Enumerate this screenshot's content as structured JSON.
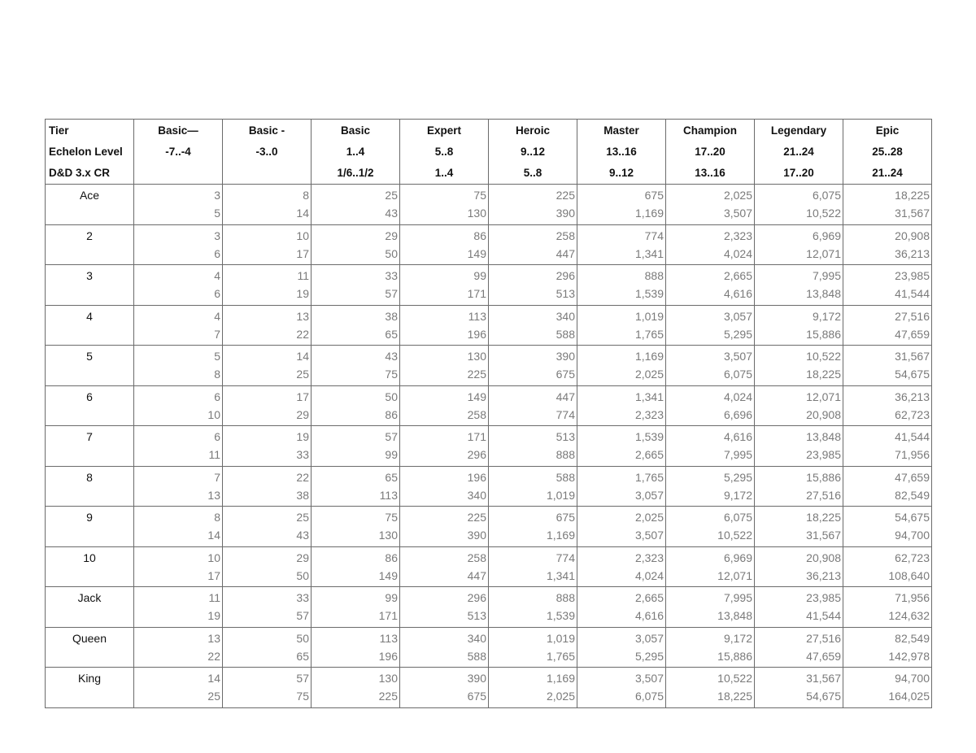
{
  "table": {
    "header_rows": [
      {
        "label": "Tier",
        "values": [
          "Basic—",
          "Basic -",
          "Basic",
          "Expert",
          "Heroic",
          "Master",
          "Champion",
          "Legendary",
          "Epic"
        ]
      },
      {
        "label": "Echelon Level",
        "values": [
          "-7..-4",
          "-3..0",
          "1..4",
          "5..8",
          "9..12",
          "13..16",
          "17..20",
          "21..24",
          "25..28"
        ]
      },
      {
        "label": "D&D 3.x CR",
        "values": [
          "",
          "",
          "1/6..1/2",
          "1..4",
          "5..8",
          "9..12",
          "13..16",
          "17..20",
          "21..24"
        ]
      }
    ],
    "rows": [
      {
        "label": "Ace",
        "top": [
          "3",
          "8",
          "25",
          "75",
          "225",
          "675",
          "2,025",
          "6,075",
          "18,225"
        ],
        "bottom": [
          "5",
          "14",
          "43",
          "130",
          "390",
          "1,169",
          "3,507",
          "10,522",
          "31,567"
        ]
      },
      {
        "label": "2",
        "top": [
          "3",
          "10",
          "29",
          "86",
          "258",
          "774",
          "2,323",
          "6,969",
          "20,908"
        ],
        "bottom": [
          "6",
          "17",
          "50",
          "149",
          "447",
          "1,341",
          "4,024",
          "12,071",
          "36,213"
        ]
      },
      {
        "label": "3",
        "top": [
          "4",
          "11",
          "33",
          "99",
          "296",
          "888",
          "2,665",
          "7,995",
          "23,985"
        ],
        "bottom": [
          "6",
          "19",
          "57",
          "171",
          "513",
          "1,539",
          "4,616",
          "13,848",
          "41,544"
        ]
      },
      {
        "label": "4",
        "top": [
          "4",
          "13",
          "38",
          "113",
          "340",
          "1,019",
          "3,057",
          "9,172",
          "27,516"
        ],
        "bottom": [
          "7",
          "22",
          "65",
          "196",
          "588",
          "1,765",
          "5,295",
          "15,886",
          "47,659"
        ]
      },
      {
        "label": "5",
        "top": [
          "5",
          "14",
          "43",
          "130",
          "390",
          "1,169",
          "3,507",
          "10,522",
          "31,567"
        ],
        "bottom": [
          "8",
          "25",
          "75",
          "225",
          "675",
          "2,025",
          "6,075",
          "18,225",
          "54,675"
        ]
      },
      {
        "label": "6",
        "top": [
          "6",
          "17",
          "50",
          "149",
          "447",
          "1,341",
          "4,024",
          "12,071",
          "36,213"
        ],
        "bottom": [
          "10",
          "29",
          "86",
          "258",
          "774",
          "2,323",
          "6,696",
          "20,908",
          "62,723"
        ]
      },
      {
        "label": "7",
        "top": [
          "6",
          "19",
          "57",
          "171",
          "513",
          "1,539",
          "4,616",
          "13,848",
          "41,544"
        ],
        "bottom": [
          "11",
          "33",
          "99",
          "296",
          "888",
          "2,665",
          "7,995",
          "23,985",
          "71,956"
        ]
      },
      {
        "label": "8",
        "top": [
          "7",
          "22",
          "65",
          "196",
          "588",
          "1,765",
          "5,295",
          "15,886",
          "47,659"
        ],
        "bottom": [
          "13",
          "38",
          "113",
          "340",
          "1,019",
          "3,057",
          "9,172",
          "27,516",
          "82,549"
        ]
      },
      {
        "label": "9",
        "top": [
          "8",
          "25",
          "75",
          "225",
          "675",
          "2,025",
          "6,075",
          "18,225",
          "54,675"
        ],
        "bottom": [
          "14",
          "43",
          "130",
          "390",
          "1,169",
          "3,507",
          "10,522",
          "31,567",
          "94,700"
        ]
      },
      {
        "label": "10",
        "top": [
          "10",
          "29",
          "86",
          "258",
          "774",
          "2,323",
          "6,969",
          "20,908",
          "62,723"
        ],
        "bottom": [
          "17",
          "50",
          "149",
          "447",
          "1,341",
          "4,024",
          "12,071",
          "36,213",
          "108,640"
        ]
      },
      {
        "label": "Jack",
        "top": [
          "11",
          "33",
          "99",
          "296",
          "888",
          "2,665",
          "7,995",
          "23,985",
          "71,956"
        ],
        "bottom": [
          "19",
          "57",
          "171",
          "513",
          "1,539",
          "4,616",
          "13,848",
          "41,544",
          "124,632"
        ]
      },
      {
        "label": "Queen",
        "top": [
          "13",
          "50",
          "113",
          "340",
          "1,019",
          "3,057",
          "9,172",
          "27,516",
          "82,549"
        ],
        "bottom": [
          "22",
          "65",
          "196",
          "588",
          "1,765",
          "5,295",
          "15,886",
          "47,659",
          "142,978"
        ]
      },
      {
        "label": "King",
        "top": [
          "14",
          "57",
          "130",
          "390",
          "1,169",
          "3,507",
          "10,522",
          "31,567",
          "94,700"
        ],
        "bottom": [
          "25",
          "75",
          "225",
          "675",
          "2,025",
          "6,075",
          "18,225",
          "54,675",
          "164,025"
        ]
      }
    ]
  }
}
